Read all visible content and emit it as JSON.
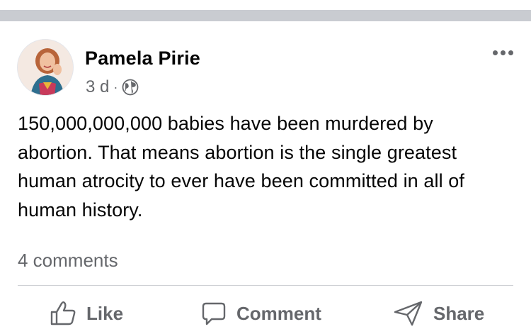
{
  "post": {
    "author_name": "Pamela Pirie",
    "timestamp": "3 d",
    "separator": "·",
    "privacy_icon": "globe-icon",
    "more_icon": "more-options-icon",
    "text": "150,000,000,000 babies have been murdered by abortion. That means abortion is the single greatest human atrocity to ever have been committed in all of human history.",
    "comments_count": "4 comments"
  },
  "actions": {
    "like_label": "Like",
    "comment_label": "Comment",
    "share_label": "Share"
  },
  "colors": {
    "primary_text": "#050505",
    "secondary_text": "#65676b",
    "divider": "#ced0d4",
    "top_stripe": "#c9ccd1"
  }
}
